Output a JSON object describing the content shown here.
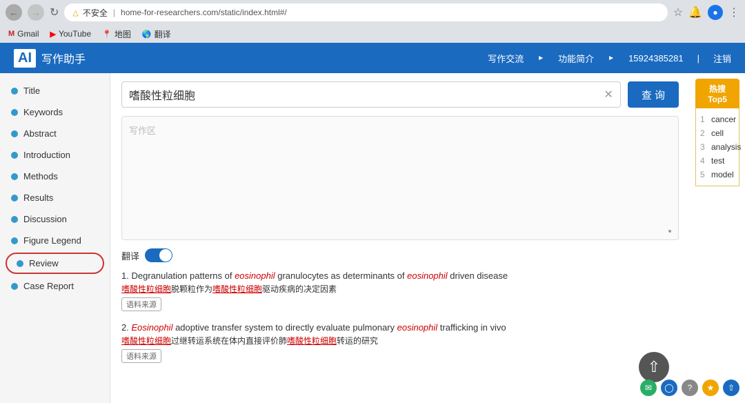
{
  "browser": {
    "address": "home-for-researchers.com/static/index.html#/",
    "warning_text": "不安全",
    "bookmarks": [
      {
        "label": "Gmail",
        "type": "gmail"
      },
      {
        "label": "YouTube",
        "type": "youtube"
      },
      {
        "label": "地图",
        "type": "maps"
      },
      {
        "label": "翻译",
        "type": "translate"
      }
    ]
  },
  "header": {
    "logo_text": "写作助手",
    "nav_items": [
      "写作交流",
      "功能简介"
    ],
    "phone": "15924385281",
    "logout": "注销"
  },
  "sidebar": {
    "items": [
      {
        "id": "title",
        "label": "Title"
      },
      {
        "id": "keywords",
        "label": "Keywords"
      },
      {
        "id": "abstract",
        "label": "Abstract"
      },
      {
        "id": "introduction",
        "label": "Introduction"
      },
      {
        "id": "methods",
        "label": "Methods"
      },
      {
        "id": "results",
        "label": "Results"
      },
      {
        "id": "discussion",
        "label": "Discussion"
      },
      {
        "id": "figure-legend",
        "label": "Figure Legend"
      },
      {
        "id": "review",
        "label": "Review",
        "active": true
      },
      {
        "id": "case-report",
        "label": "Case Report"
      }
    ]
  },
  "search": {
    "query": "嗜酸性粒细胞",
    "placeholder": "写作区",
    "btn_label": "查 询"
  },
  "translation": {
    "label": "翻译",
    "enabled": true
  },
  "hot_top5": {
    "title": "热搜 Top5",
    "items": [
      {
        "rank": 1,
        "word": "cancer"
      },
      {
        "rank": 2,
        "word": "cell"
      },
      {
        "rank": 3,
        "word": "analysis"
      },
      {
        "rank": 4,
        "word": "test"
      },
      {
        "rank": 5,
        "word": "model"
      }
    ]
  },
  "results": [
    {
      "number": "1.",
      "prefix": "Degranulation patterns of ",
      "keyword1": "eosinophil",
      "middle": " granulocytes as determinants of ",
      "keyword2": "eosinophil",
      "suffix": " driven disease",
      "zh_prefix": "",
      "zh_keyword1": "嗜酸性粒细胞",
      "zh_middle": "脱颗粒作为",
      "zh_keyword2": "嗜酸性粒细胞",
      "zh_suffix": "驱动疾病的决定因素",
      "source_tag": "语料来源"
    },
    {
      "number": "2.",
      "prefix": "",
      "keyword1": "Eosinophil",
      "middle": " adoptive transfer system to directly evaluate pulmonary ",
      "keyword2": "eosinophil",
      "suffix": " trafficking in vivo",
      "zh_prefix": "",
      "zh_keyword1": "嗜酸性粒细胞",
      "zh_middle": "过继转运系统在体内直接评价肺",
      "zh_keyword2": "嗜酸性粒细胞",
      "zh_suffix": "转运的研究",
      "source_tag": "语料来源"
    }
  ]
}
